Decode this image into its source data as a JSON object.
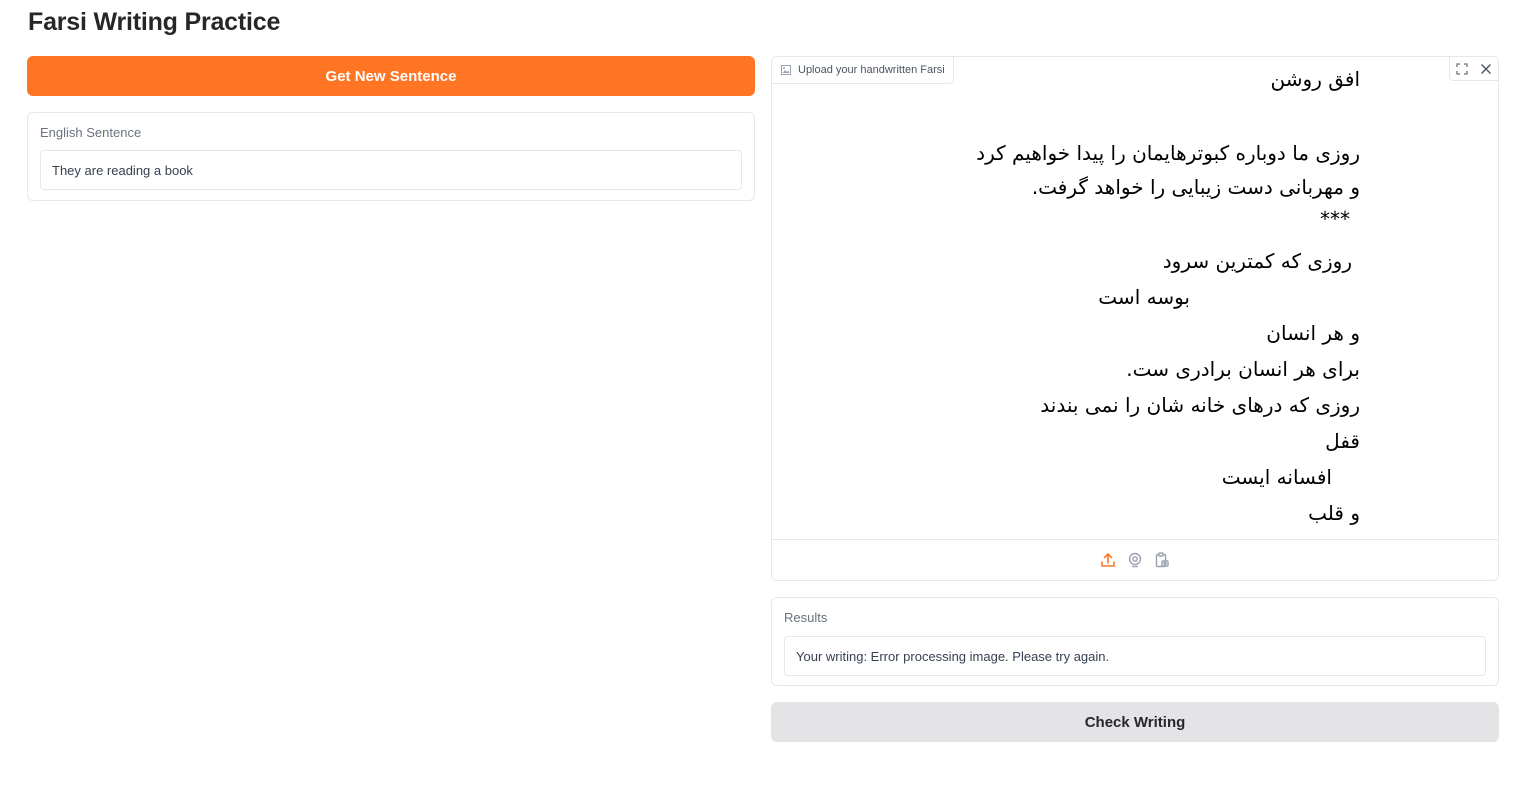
{
  "title": "Farsi Writing Practice",
  "buttons": {
    "get_new_sentence": "Get New Sentence",
    "check_writing": "Check Writing"
  },
  "english_sentence": {
    "label": "English Sentence",
    "value": "They are reading a book"
  },
  "upload": {
    "label": "Upload your handwritten Farsi",
    "image_lines": [
      "افق روشن",
      "روزی ما دوباره کبوترهایمان را پیدا خواهیم کرد",
      "و مهربانی دست زیبایی را خواهد گرفت.",
      "***",
      "روزی که کمترین سرود",
      "بوسه است",
      "و هر انسان",
      "برای هر انسان برادری ست.",
      "روزی که درهای خانه شان را نمی بندند",
      "قفل",
      "افسانه ایست",
      "و قلب"
    ]
  },
  "results": {
    "label": "Results",
    "value": "Your writing: Error processing image. Please try again."
  },
  "colors": {
    "primary": "#ff7524",
    "secondary_button": "#e4e4e7",
    "border": "#e5e7eb"
  },
  "icons": {
    "image_tag": "image-icon",
    "fullscreen": "fullscreen-icon",
    "close": "close-icon",
    "upload": "upload-icon",
    "webcam": "webcam-icon",
    "clipboard": "clipboard-icon"
  }
}
